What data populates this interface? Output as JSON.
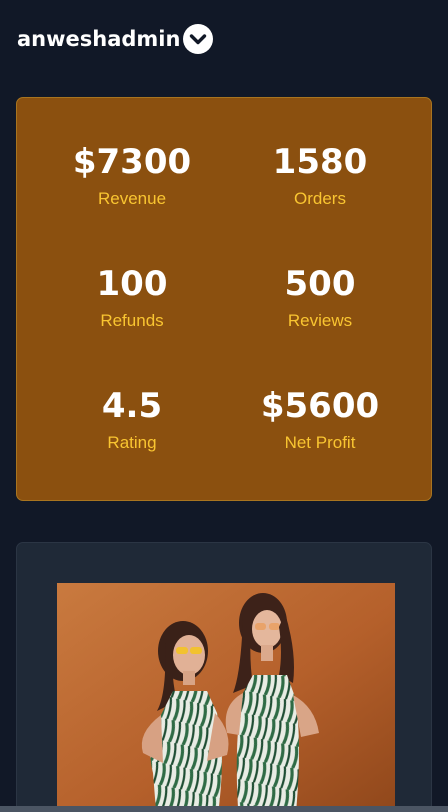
{
  "header": {
    "username": "anweshadmin",
    "menu_icon": "chevron-down-icon"
  },
  "stats": [
    {
      "value": "$7300",
      "label": "Revenue"
    },
    {
      "value": "1580",
      "label": "Orders"
    },
    {
      "value": "100",
      "label": "Refunds"
    },
    {
      "value": "500",
      "label": "Reviews"
    },
    {
      "value": "4.5",
      "label": "Rating"
    },
    {
      "value": "$5600",
      "label": "Net Profit"
    }
  ],
  "colors": {
    "background": "#111827",
    "stats_card": "#8b500f",
    "stat_label": "#f9c531",
    "image_card": "#1f2937"
  },
  "image": {
    "subject": "product-photo"
  }
}
